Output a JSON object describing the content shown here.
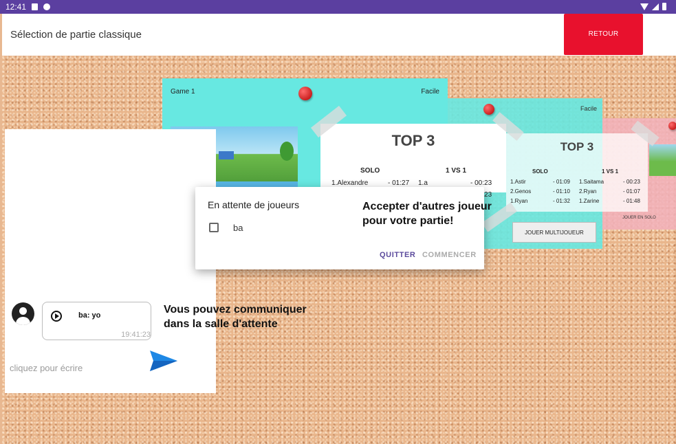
{
  "status_bar": {
    "time": "12:41"
  },
  "app_bar": {
    "title": "Sélection de partie classique",
    "back_label": "RETOUR"
  },
  "cards": [
    {
      "name": "Game 1",
      "difficulty": "Facile",
      "top3_title": "TOP 3",
      "solo_header": "SOLO",
      "vs_header": "1 VS 1",
      "solo": [
        {
          "name": "1.Alexandre",
          "time": "- 01:27"
        }
      ],
      "vs": [
        {
          "name": "1.a",
          "time": "- 00:23"
        },
        {
          "time": "- 00:23"
        }
      ]
    },
    {
      "difficulty": "Facile",
      "top3_title": "TOP 3",
      "solo_header": "SOLO",
      "vs_header": "1 VS 1",
      "solo": [
        {
          "name": "1.Astir",
          "time": "- 01:09"
        },
        {
          "name": "2.Genos",
          "time": "- 01:10"
        },
        {
          "name": "1.Ryan",
          "time": "- 01:32"
        }
      ],
      "vs": [
        {
          "name": "1.Saitama",
          "time": "- 00:23"
        },
        {
          "name": "2.Ryan",
          "time": "- 01:07"
        },
        {
          "name": "1.Zarine",
          "time": "- 01:48"
        }
      ],
      "multi_label": "JOUER MULTIJOUEUR"
    },
    {
      "multi_label": "JOUER EN SOLO"
    }
  ],
  "chat": {
    "message": "ba: yo",
    "message_time": "19:41:23",
    "input_placeholder": "cliquez pour écrire",
    "hint": "Vous pouvez communiquer dans la salle d'attente"
  },
  "dialog": {
    "title": "En attente de joueurs",
    "player": "ba",
    "player_checked": false,
    "quit_label": "QUITTER",
    "start_label": "COMMENCER",
    "hint": "Accepter d'autres joueur pour votre partie!"
  },
  "colors": {
    "accent": "#5b3fa0",
    "danger": "#e8112d",
    "card": "#67e8e1",
    "send": "#1e88e5"
  }
}
